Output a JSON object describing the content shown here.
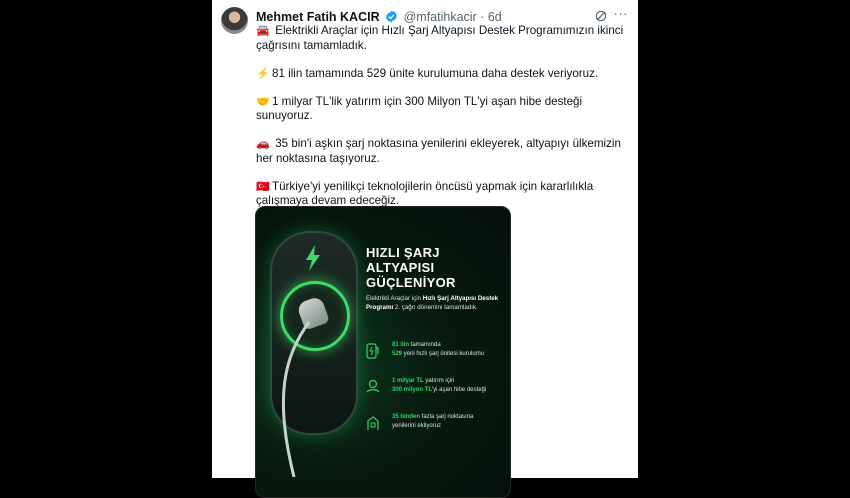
{
  "tweet": {
    "author_name": "Mehmet Fatih KACIR",
    "handle": "@mfatihkacir",
    "separator": "·",
    "time_ago": "6d",
    "more_label": "···",
    "verified_color": "#1d9bf0",
    "paragraphs": [
      {
        "icon": "car-emoji",
        "emoji": "🚘",
        "text": "Elektrikli Araçlar için Hızlı Şarj Altyapısı Destek Programımızın ikinci çağrısını tamamladık."
      },
      {
        "icon": "lightning-emoji",
        "emoji": "⚡",
        "text": "81 ilin tamamında 529 ünite kurulumuna daha destek veriyoruz."
      },
      {
        "icon": "handshake-emoji",
        "emoji": "🤝",
        "text": "1 milyar TL'lik yatırım için 300 Milyon TL'yi aşan hibe desteği sunuyoruz."
      },
      {
        "icon": "car-emoji",
        "emoji": "🚗",
        "text": "35 bin'i aşkın şarj noktasına yenilerini ekleyerek, altyapıyı ülkemizin her noktasına taşıyoruz."
      },
      {
        "icon": "turkey-flag-emoji",
        "emoji": "🇹🇷",
        "text": "Türkiye'yi yenilikçi teknolojilerin öncüsü yapmak için kararlılıkla çalışmaya devam edeceğiz."
      }
    ]
  },
  "media": {
    "title_line1": "HIZLI ŞARJ ALTYAPISI",
    "title_line2": "GÜÇLENİYOR",
    "intro_pre": "Elektrikli Araçlar için ",
    "intro_bold": "Hızlı Şarj Altyapısı Destek Programı",
    "intro_post": " 2. çağrı dönemini tamamladık.",
    "items": [
      {
        "icon": "charger-icon",
        "hl1": "81 ilin",
        "t1": " tamamında",
        "hl2": "529",
        "t2": " yeni hızlı şarj ünitesi kurulumu"
      },
      {
        "icon": "money-icon",
        "hl1": "1 milyar TL",
        "t1": " yatırım için",
        "hl2": "300 milyon TL",
        "t2": "'yi aşan hibe desteği"
      },
      {
        "icon": "station-icon",
        "hl1": "35 binden",
        "t1": " fazla şarj noktasına",
        "hl2": "",
        "t2": "yenilerini ekliyoruz"
      }
    ],
    "accent": "#35d46a"
  }
}
